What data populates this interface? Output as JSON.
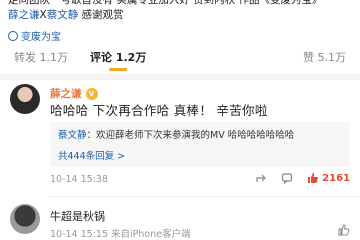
{
  "post": {
    "top_line": "走同团队一号歌首没有 实属专业加入好 赞到内秋  作品《变废为宝》",
    "line2_prefix": "薛之谦",
    "line2_mid": "X",
    "line2_name": "蔡文静",
    "line2_suffix": " 感谢观赏",
    "link_text": "变废为宝"
  },
  "tabs": {
    "repost": "转发 1.1万",
    "comments": "评论 1.2万",
    "likes": "赞 5.1万"
  },
  "comment": {
    "author": "薛之谦",
    "badge": "V",
    "text": "哈哈哈 下次再合作哈 真棒！ 辛苦你啦",
    "reply_author": "蔡文静",
    "reply_text": "：欢迎薛老师下次来参演我的MV 哈哈哈哈哈哈哈",
    "reply_more": "共444条回复 >",
    "time": "10-14 15:38",
    "likes": "2161"
  },
  "comment2": {
    "text": "牛超是秋锅",
    "time": "10-14 15:15",
    "source": "来自iPhone客户端"
  },
  "colors": {
    "link": "#1e5ea8",
    "accent": "#f5a623",
    "author": "#e7793a",
    "like": "#e84a2f"
  }
}
